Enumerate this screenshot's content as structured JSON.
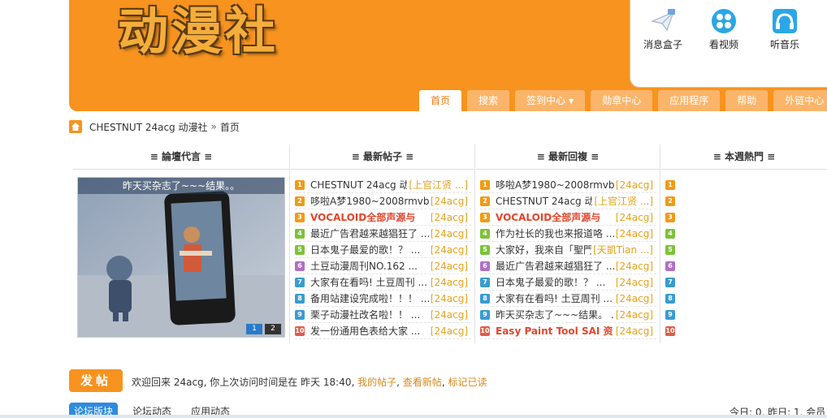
{
  "header": {
    "logo": "动漫社"
  },
  "quick": [
    {
      "label": "消息盒子",
      "icon": "message-box-icon"
    },
    {
      "label": "看视频",
      "icon": "video-icon"
    },
    {
      "label": "听音乐",
      "icon": "music-icon"
    }
  ],
  "nav": [
    {
      "label": "首页",
      "active": true
    },
    {
      "label": "搜索"
    },
    {
      "label": "签到中心",
      "dropdown": true
    },
    {
      "label": "勋章中心"
    },
    {
      "label": "应用程序"
    },
    {
      "label": "帮助"
    },
    {
      "label": "外链中心",
      "dropdown": true
    }
  ],
  "breadcrumb": {
    "site": "CHESTNUT 24acg 动漫社",
    "sep": "»",
    "current": "首页"
  },
  "columns": {
    "ad_title": "≡ 論壇代言 ≡",
    "new_posts_title": "≡ 最新帖子 ≡",
    "new_replies_title": "≡ 最新回複 ≡",
    "hot_title": "≡ 本週熱門 ≡"
  },
  "slide": {
    "caption": "昨天买杂志了~~~结果。。",
    "pages": [
      "1",
      "2"
    ]
  },
  "new_posts": [
    {
      "n": "1",
      "title": "CHESTNUT 24acg 动",
      "tag": "[上官江贤 ...]"
    },
    {
      "n": "2",
      "title": "哆啦A梦1980~2008rmvb",
      "tag": "[24acg]"
    },
    {
      "n": "3",
      "title": "VOCALOID全部声源与",
      "tag": "[24acg]",
      "hot": true
    },
    {
      "n": "4",
      "title": "最近广告君越来越猖狂了 ...",
      "tag": "[24acg]"
    },
    {
      "n": "5",
      "title": "日本鬼子最爱的歌！？ ...",
      "tag": "[24acg]"
    },
    {
      "n": "6",
      "title": "土豆动漫周刊NO.162 ...",
      "tag": "[24acg]"
    },
    {
      "n": "7",
      "title": "大家有在看吗! 土豆周刊 ...",
      "tag": "[24acg]"
    },
    {
      "n": "8",
      "title": "备用站建设完成啦！！！ ...",
      "tag": "[24acg]"
    },
    {
      "n": "9",
      "title": "栗子动漫社改名啦！！ ...",
      "tag": "[24acg]"
    },
    {
      "n": "10",
      "title": "发一份通用色表给大家 ...",
      "tag": "[24acg]"
    }
  ],
  "new_replies": [
    {
      "n": "1",
      "title": "哆啦A梦1980~2008rmvb",
      "tag": "[24acg]"
    },
    {
      "n": "2",
      "title": "CHESTNUT 24acg 动",
      "tag": "[上官江贤 ...]"
    },
    {
      "n": "3",
      "title": "VOCALOID全部声源与",
      "tag": "[24acg]",
      "hot": true
    },
    {
      "n": "4",
      "title": "作为社长的我也来报道咯 ...",
      "tag": "[24acg]"
    },
    {
      "n": "5",
      "title": "大家好，我來自「聖門",
      "tag": "[天凱Tian ...]"
    },
    {
      "n": "6",
      "title": "最近广告君越来越猖狂了 ...",
      "tag": "[24acg]"
    },
    {
      "n": "7",
      "title": "日本鬼子最爱的歌！？ ...",
      "tag": "[24acg]"
    },
    {
      "n": "8",
      "title": "大家有在看吗! 土豆周刊 ...",
      "tag": "[24acg]"
    },
    {
      "n": "9",
      "title": "昨天买杂志了~~~结果。 ...",
      "tag": "[24acg]"
    },
    {
      "n": "10",
      "title": "Easy Paint Tool SAI 资",
      "tag": "[24acg]",
      "hot": true
    }
  ],
  "hot_nums": [
    "1",
    "2",
    "3",
    "4",
    "5",
    "6",
    "7",
    "8",
    "9",
    "10"
  ],
  "footer": {
    "post_button": "发帖",
    "welcome": "欢迎回来 24acg, 你上次访问时间是在 昨天 18:40,",
    "my_posts": "我的帖子",
    "view_new": "查看新帖",
    "mark_read": "标记已读",
    "tabs": [
      "论坛版块",
      "论坛动态",
      "应用动态"
    ],
    "stats": "今日: 0, 昨日: 1, 会员"
  },
  "colors": {
    "brand": "#f7931e",
    "tag": "#e6a21b",
    "hot": "#e2462c",
    "tab_active": "#2d8be0"
  }
}
